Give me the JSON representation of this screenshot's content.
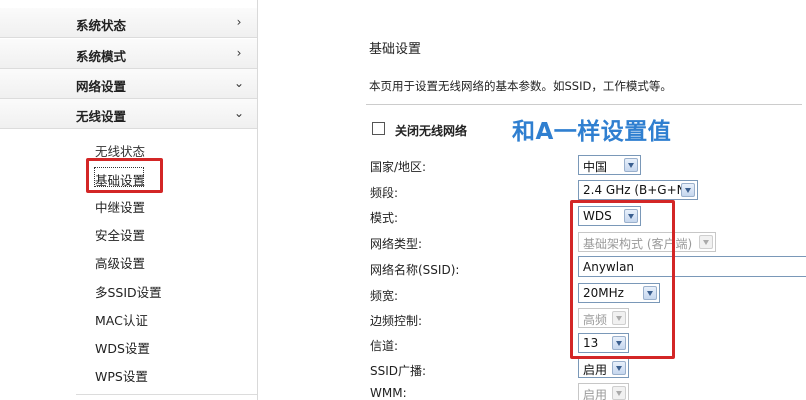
{
  "sidebar": {
    "menus": [
      {
        "label": "系统状态",
        "arrow": "›"
      },
      {
        "label": "系统模式",
        "arrow": "›"
      },
      {
        "label": "网络设置",
        "arrow": "⌄"
      },
      {
        "label": "无线设置",
        "arrow": "⌄"
      }
    ],
    "submenu": [
      {
        "label": "无线状态"
      },
      {
        "label": "基础设置"
      },
      {
        "label": "中继设置"
      },
      {
        "label": "安全设置"
      },
      {
        "label": "高级设置"
      },
      {
        "label": "多SSID设置"
      },
      {
        "label": "MAC认证"
      },
      {
        "label": "WDS设置"
      },
      {
        "label": "WPS设置"
      }
    ]
  },
  "main": {
    "title": "基础设置",
    "description": "本页用于设置无线网络的基本参数。如SSID，工作模式等。",
    "disable_wifi_label": "关闭无线网络",
    "annotation": "和A一样设置值",
    "fields": {
      "country": {
        "label": "国家/地区:",
        "value": "中国"
      },
      "band": {
        "label": "频段:",
        "value": "2.4 GHz (B+G+N)"
      },
      "mode": {
        "label": "模式:",
        "value": "WDS"
      },
      "network_type": {
        "label": "网络类型:",
        "value": "基础架构式 (客户端)"
      },
      "ssid": {
        "label": "网络名称(SSID):",
        "value": "Anywlan"
      },
      "bandwidth": {
        "label": "频宽:",
        "value": "20MHz"
      },
      "sideband": {
        "label": "边频控制:",
        "value": "高频"
      },
      "channel": {
        "label": "信道:",
        "value": "13"
      },
      "ssid_broadcast": {
        "label": "SSID广播:",
        "value": "启用"
      },
      "wmm": {
        "label": "WMM:",
        "value": "启用"
      }
    }
  },
  "colors": {
    "annotation": "#2f7fd0",
    "highlight_box": "#d32626",
    "select_border": "#7a98b8"
  }
}
